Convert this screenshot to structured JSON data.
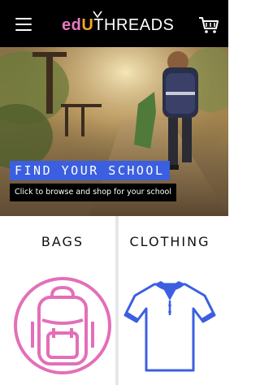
{
  "header": {
    "logo_edu": "ed",
    "logo_u": "U",
    "logo_threads": "THREADS"
  },
  "icons": {
    "menu": "hamburger-menu-icon",
    "cart": "shopping-cart-icon",
    "bags": "backpack-icon",
    "clothing": "polo-shirt-icon"
  },
  "hero": {
    "title": "FIND YOUR SCHOOL",
    "subtitle": "Click to browse and shop for your school"
  },
  "categories": [
    {
      "label": "BAGS"
    },
    {
      "label": "CLOTHING"
    }
  ],
  "colors": {
    "header_bg": "#000000",
    "logo_pink": "#e87bc1",
    "logo_orange": "#f5a623",
    "hero_title_bg": "#3b5fe0",
    "bags_icon": "#e36fb8",
    "clothing_icon": "#3b5fe0"
  }
}
